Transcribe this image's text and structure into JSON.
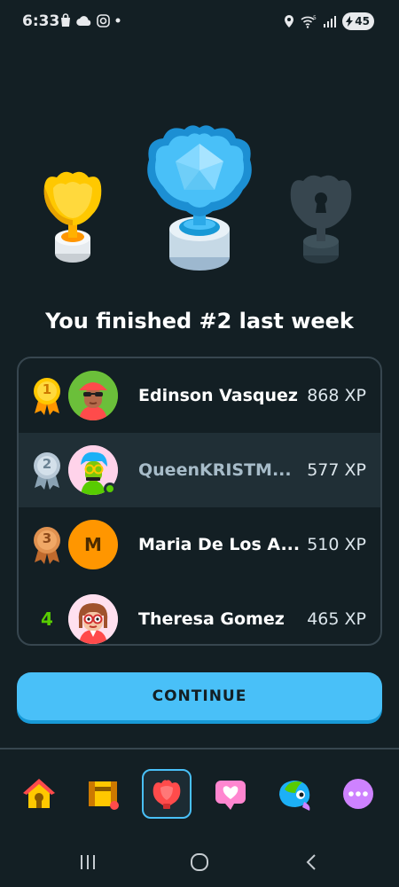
{
  "status_bar": {
    "time": "6:33",
    "battery": "45"
  },
  "headline": "You finished #2 last week",
  "leaderboard": [
    {
      "rank": "1",
      "rank_style": "gold-medal",
      "name": "Edinson Vasquez",
      "xp": "868 XP"
    },
    {
      "rank": "2",
      "rank_style": "silver-medal",
      "name": "QueenKRISTM...",
      "xp": "577 XP",
      "is_current_user": true
    },
    {
      "rank": "3",
      "rank_style": "bronze-medal",
      "name": "Maria De Los A...",
      "xp": "510 XP",
      "avatar_letter": "M"
    },
    {
      "rank": "4",
      "rank_style": "number",
      "name": "Theresa Gomez",
      "xp": "465 XP"
    }
  ],
  "continue_label": "CONTINUE",
  "bottom_nav": [
    "home-icon",
    "quests-chest-icon",
    "leagues-shield-icon",
    "practice-heart-icon",
    "characters-icon",
    "more-icon"
  ],
  "colors": {
    "background": "#131f24",
    "accent_blue": "#49c0f8",
    "border": "#37464f",
    "highlight_row": "#202f36",
    "green": "#58cc02"
  }
}
